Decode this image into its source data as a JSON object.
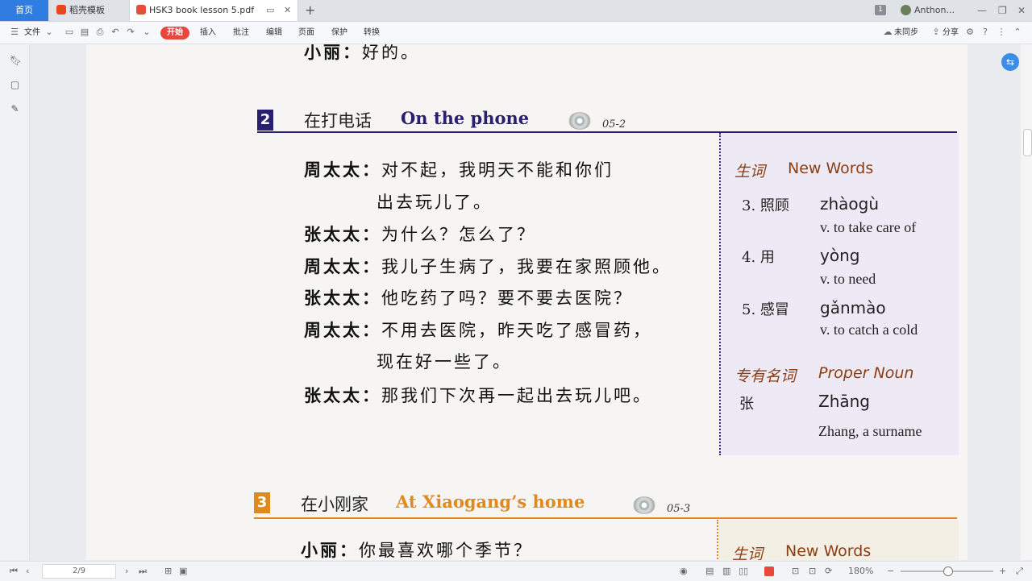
{
  "tabs": {
    "home": "首页",
    "templates": "稻壳模板",
    "active_file": "HSK3 book lesson 5.pdf"
  },
  "titlebar": {
    "page_badge": "1",
    "user": "Anthon..."
  },
  "ribbon": {
    "file": "文件",
    "start": "开始",
    "insert": "插入",
    "annotate": "批注",
    "edit": "编辑",
    "page": "页面",
    "protect": "保护",
    "convert": "转换",
    "sync": "未同步",
    "share": "分享"
  },
  "content": {
    "prev_line": {
      "speaker": "小丽：",
      "text": "好的。"
    },
    "section2": {
      "num": "2",
      "title_cn": "在打电话",
      "title_en": "On the phone",
      "code": "05-2",
      "color": "#2a1f6e",
      "dialogue": [
        {
          "speaker": "周太太：",
          "text": "对不起，我明天不能和你们"
        },
        {
          "speaker": "",
          "text": "出去玩儿了。"
        },
        {
          "speaker": "张太太：",
          "text": "为什么？怎么了？"
        },
        {
          "speaker": "周太太：",
          "text": "我儿子生病了，我要在家照顾他。"
        },
        {
          "speaker": "张太太：",
          "text": "他吃药了吗？要不要去医院？"
        },
        {
          "speaker": "周太太：",
          "text": "不用去医院，昨天吃了感冒药，"
        },
        {
          "speaker": "",
          "text": "现在好一些了。"
        },
        {
          "speaker": "张太太：",
          "text": "那我们下次再一起出去玩儿吧。"
        }
      ],
      "new_words_cn": "生词",
      "new_words_en": "New Words",
      "words": [
        {
          "num": "3. 照顾",
          "pinyin": "zhàogù",
          "def": "v. to take care of"
        },
        {
          "num": "4. 用",
          "pinyin": "yòng",
          "def": "v. to need"
        },
        {
          "num": "5. 感冒",
          "pinyin": "gǎnmào",
          "def": "v. to catch a cold"
        }
      ],
      "proper_cn": "专有名词",
      "proper_en": "Proper Noun",
      "proper": {
        "word": "张",
        "pinyin": "Zhāng",
        "def": "Zhang, a surname"
      }
    },
    "section3": {
      "num": "3",
      "title_cn": "在小刚家",
      "title_en": "At Xiaogang’s home",
      "code": "05-3",
      "color": "#e08a1e",
      "first_line": {
        "speaker": "小丽：",
        "text": "你最喜欢哪个季节？"
      },
      "new_words_cn": "生词",
      "new_words_en": "New Words"
    }
  },
  "statusbar": {
    "page_indicator": "2/9",
    "zoom": "180%"
  },
  "colors": {
    "accent_blue": "#2f7de1",
    "start_red": "#e8473d",
    "section2": "#2a1f6e",
    "section3": "#e08a1e",
    "word_head": "#8a3d12"
  }
}
